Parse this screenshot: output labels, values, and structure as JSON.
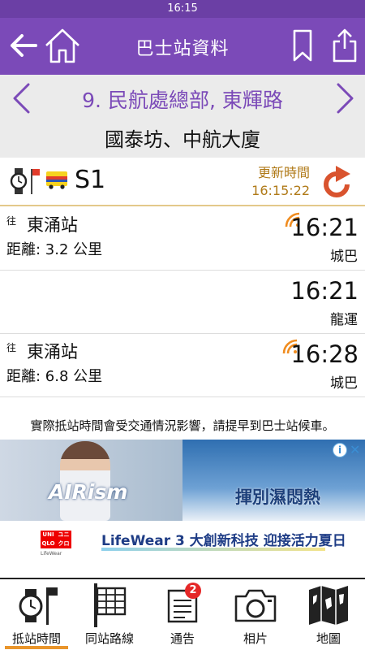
{
  "status_bar": {
    "time": "16:15"
  },
  "navbar": {
    "title": "巴士站資料",
    "back_icon": "back-arrow-icon",
    "home_icon": "home-icon",
    "bookmark_icon": "bookmark-icon",
    "share_icon": "share-icon",
    "accent_color": "#7b4ab8"
  },
  "station": {
    "name": "9. 民航處總部, 東輝路",
    "stop_name": "國泰坊、中航大廈"
  },
  "route": {
    "number": "S1",
    "update_label": "更新時間",
    "update_time": "16:15:22",
    "icons": [
      "watch-icon",
      "stop-flag-icon",
      "bus-icon",
      "refresh-icon"
    ]
  },
  "arrivals": [
    {
      "to": "往",
      "destination": "東涌站",
      "distance": "距離: 3.2 公里",
      "eta": "16:21",
      "company": "城巴",
      "realtime": true
    },
    {
      "to": "",
      "destination": "",
      "distance": "",
      "eta": "16:21",
      "company": "龍運",
      "realtime": false
    },
    {
      "to": "往",
      "destination": "東涌站",
      "distance": "距離: 6.8 公里",
      "eta": "16:28",
      "company": "城巴",
      "realtime": true
    }
  ],
  "notice": "實際抵站時間會受交通情況影響，請提早到巴士站候車。",
  "ad": {
    "brand": "AIRism",
    "headline": "揮別濕悶熱",
    "logo_top": "UNI",
    "logo_bottom": "QLO",
    "logo_top_alt": "ユニ",
    "logo_bottom_alt": "クロ",
    "lifewear_small": "LifeWear",
    "tagline": "LifeWear 3 大創新科技 迎接活力夏日",
    "info_icon": "ad-info-icon",
    "close_label": "✕"
  },
  "tabs": [
    {
      "label": "抵站時間",
      "icon": "watch-stop-icon",
      "active": true
    },
    {
      "label": "同站路線",
      "icon": "route-board-icon",
      "active": false
    },
    {
      "label": "通告",
      "icon": "notice-icon",
      "badge": "2",
      "active": false
    },
    {
      "label": "相片",
      "icon": "camera-icon",
      "active": false
    },
    {
      "label": "地圖",
      "icon": "map-icon",
      "active": false
    }
  ],
  "colors": {
    "update_text": "#b07a18",
    "refresh": "#d9532e",
    "realtime": "#f08c1f",
    "underline": "#e9952b",
    "badge": "#e52727"
  }
}
